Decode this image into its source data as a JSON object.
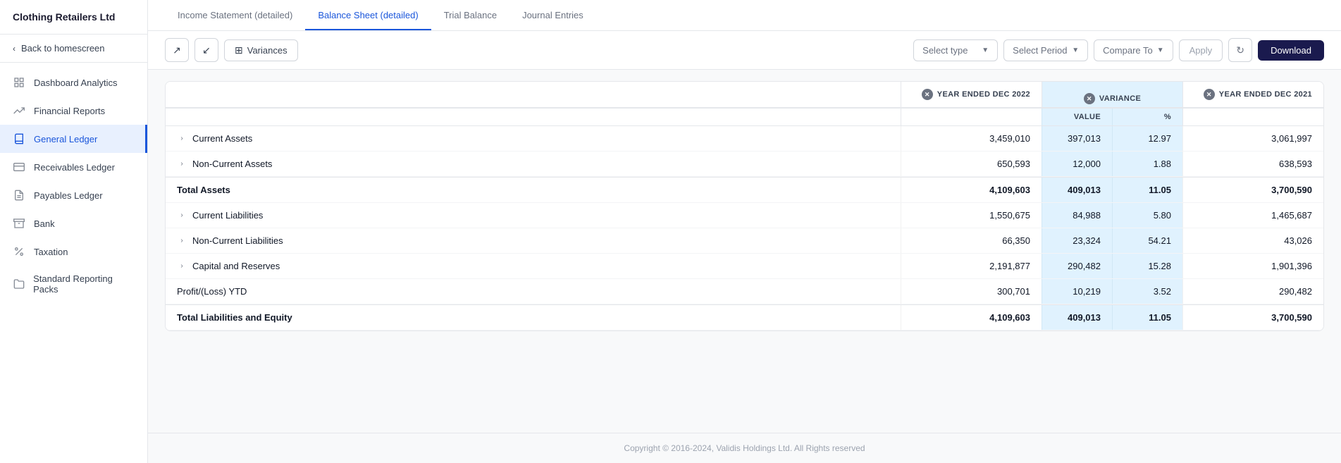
{
  "sidebar": {
    "logo": "Clothing Retailers Ltd",
    "back_label": "Back to homescreen",
    "items": [
      {
        "id": "dashboard-analytics",
        "label": "Dashboard Analytics",
        "icon": "grid"
      },
      {
        "id": "financial-reports",
        "label": "Financial Reports",
        "icon": "trending-up"
      },
      {
        "id": "general-ledger",
        "label": "General Ledger",
        "icon": "book",
        "active": true
      },
      {
        "id": "receivables-ledger",
        "label": "Receivables Ledger",
        "icon": "credit-card"
      },
      {
        "id": "payables-ledger",
        "label": "Payables Ledger",
        "icon": "file-text"
      },
      {
        "id": "bank",
        "label": "Bank",
        "icon": "archive"
      },
      {
        "id": "taxation",
        "label": "Taxation",
        "icon": "percent"
      },
      {
        "id": "standard-reporting",
        "label": "Standard Reporting Packs",
        "icon": "folder"
      }
    ]
  },
  "tabs": [
    {
      "id": "income-statement",
      "label": "Income Statement (detailed)",
      "active": false
    },
    {
      "id": "balance-sheet",
      "label": "Balance Sheet (detailed)",
      "active": true
    },
    {
      "id": "trial-balance",
      "label": "Trial Balance",
      "active": false
    },
    {
      "id": "journal-entries",
      "label": "Journal Entries",
      "active": false
    }
  ],
  "toolbar": {
    "variances_label": "Variances",
    "select_type_placeholder": "Select type",
    "select_period_placeholder": "Select Period",
    "compare_to_label": "Compare To",
    "apply_label": "Apply",
    "download_label": "Download"
  },
  "table": {
    "col1_label": "",
    "col2_label": "YEAR ENDED DEC 2022",
    "variance_label": "VARIANCE",
    "variance_sub1": "VALUE",
    "variance_sub2": "%",
    "col4_label": "YEAR ENDED DEC 2021",
    "rows": [
      {
        "id": "current-assets",
        "label": "Current Assets",
        "expandable": true,
        "bold": false,
        "col2": "3,459,010",
        "var_val": "397,013",
        "var_pct": "12.97",
        "col4": "3,061,997"
      },
      {
        "id": "non-current-assets",
        "label": "Non-Current Assets",
        "expandable": true,
        "bold": false,
        "col2": "650,593",
        "var_val": "12,000",
        "var_pct": "1.88",
        "col4": "638,593"
      },
      {
        "id": "total-assets",
        "label": "Total Assets",
        "expandable": false,
        "bold": true,
        "col2": "4,109,603",
        "var_val": "409,013",
        "var_pct": "11.05",
        "col4": "3,700,590"
      },
      {
        "id": "current-liabilities",
        "label": "Current Liabilities",
        "expandable": true,
        "bold": false,
        "col2": "1,550,675",
        "var_val": "84,988",
        "var_pct": "5.80",
        "col4": "1,465,687"
      },
      {
        "id": "non-current-liabilities",
        "label": "Non-Current Liabilities",
        "expandable": true,
        "bold": false,
        "col2": "66,350",
        "var_val": "23,324",
        "var_pct": "54.21",
        "col4": "43,026"
      },
      {
        "id": "capital-reserves",
        "label": "Capital and Reserves",
        "expandable": true,
        "bold": false,
        "col2": "2,191,877",
        "var_val": "290,482",
        "var_pct": "15.28",
        "col4": "1,901,396"
      },
      {
        "id": "profit-loss-ytd",
        "label": "Profit/(Loss) YTD",
        "expandable": false,
        "bold": false,
        "col2": "300,701",
        "var_val": "10,219",
        "var_pct": "3.52",
        "col4": "290,482"
      },
      {
        "id": "total-liabilities-equity",
        "label": "Total Liabilities and Equity",
        "expandable": false,
        "bold": true,
        "col2": "4,109,603",
        "var_val": "409,013",
        "var_pct": "11.05",
        "col4": "3,700,590"
      }
    ]
  },
  "footer": {
    "copyright": "Copyright © 2016-2024, Validis Holdings Ltd. All Rights reserved"
  },
  "colors": {
    "active_blue": "#1a56db",
    "sidebar_active_bg": "#e8f0fe",
    "variance_bg": "#e0f2fe",
    "dark_navy": "#1a1a4e"
  }
}
